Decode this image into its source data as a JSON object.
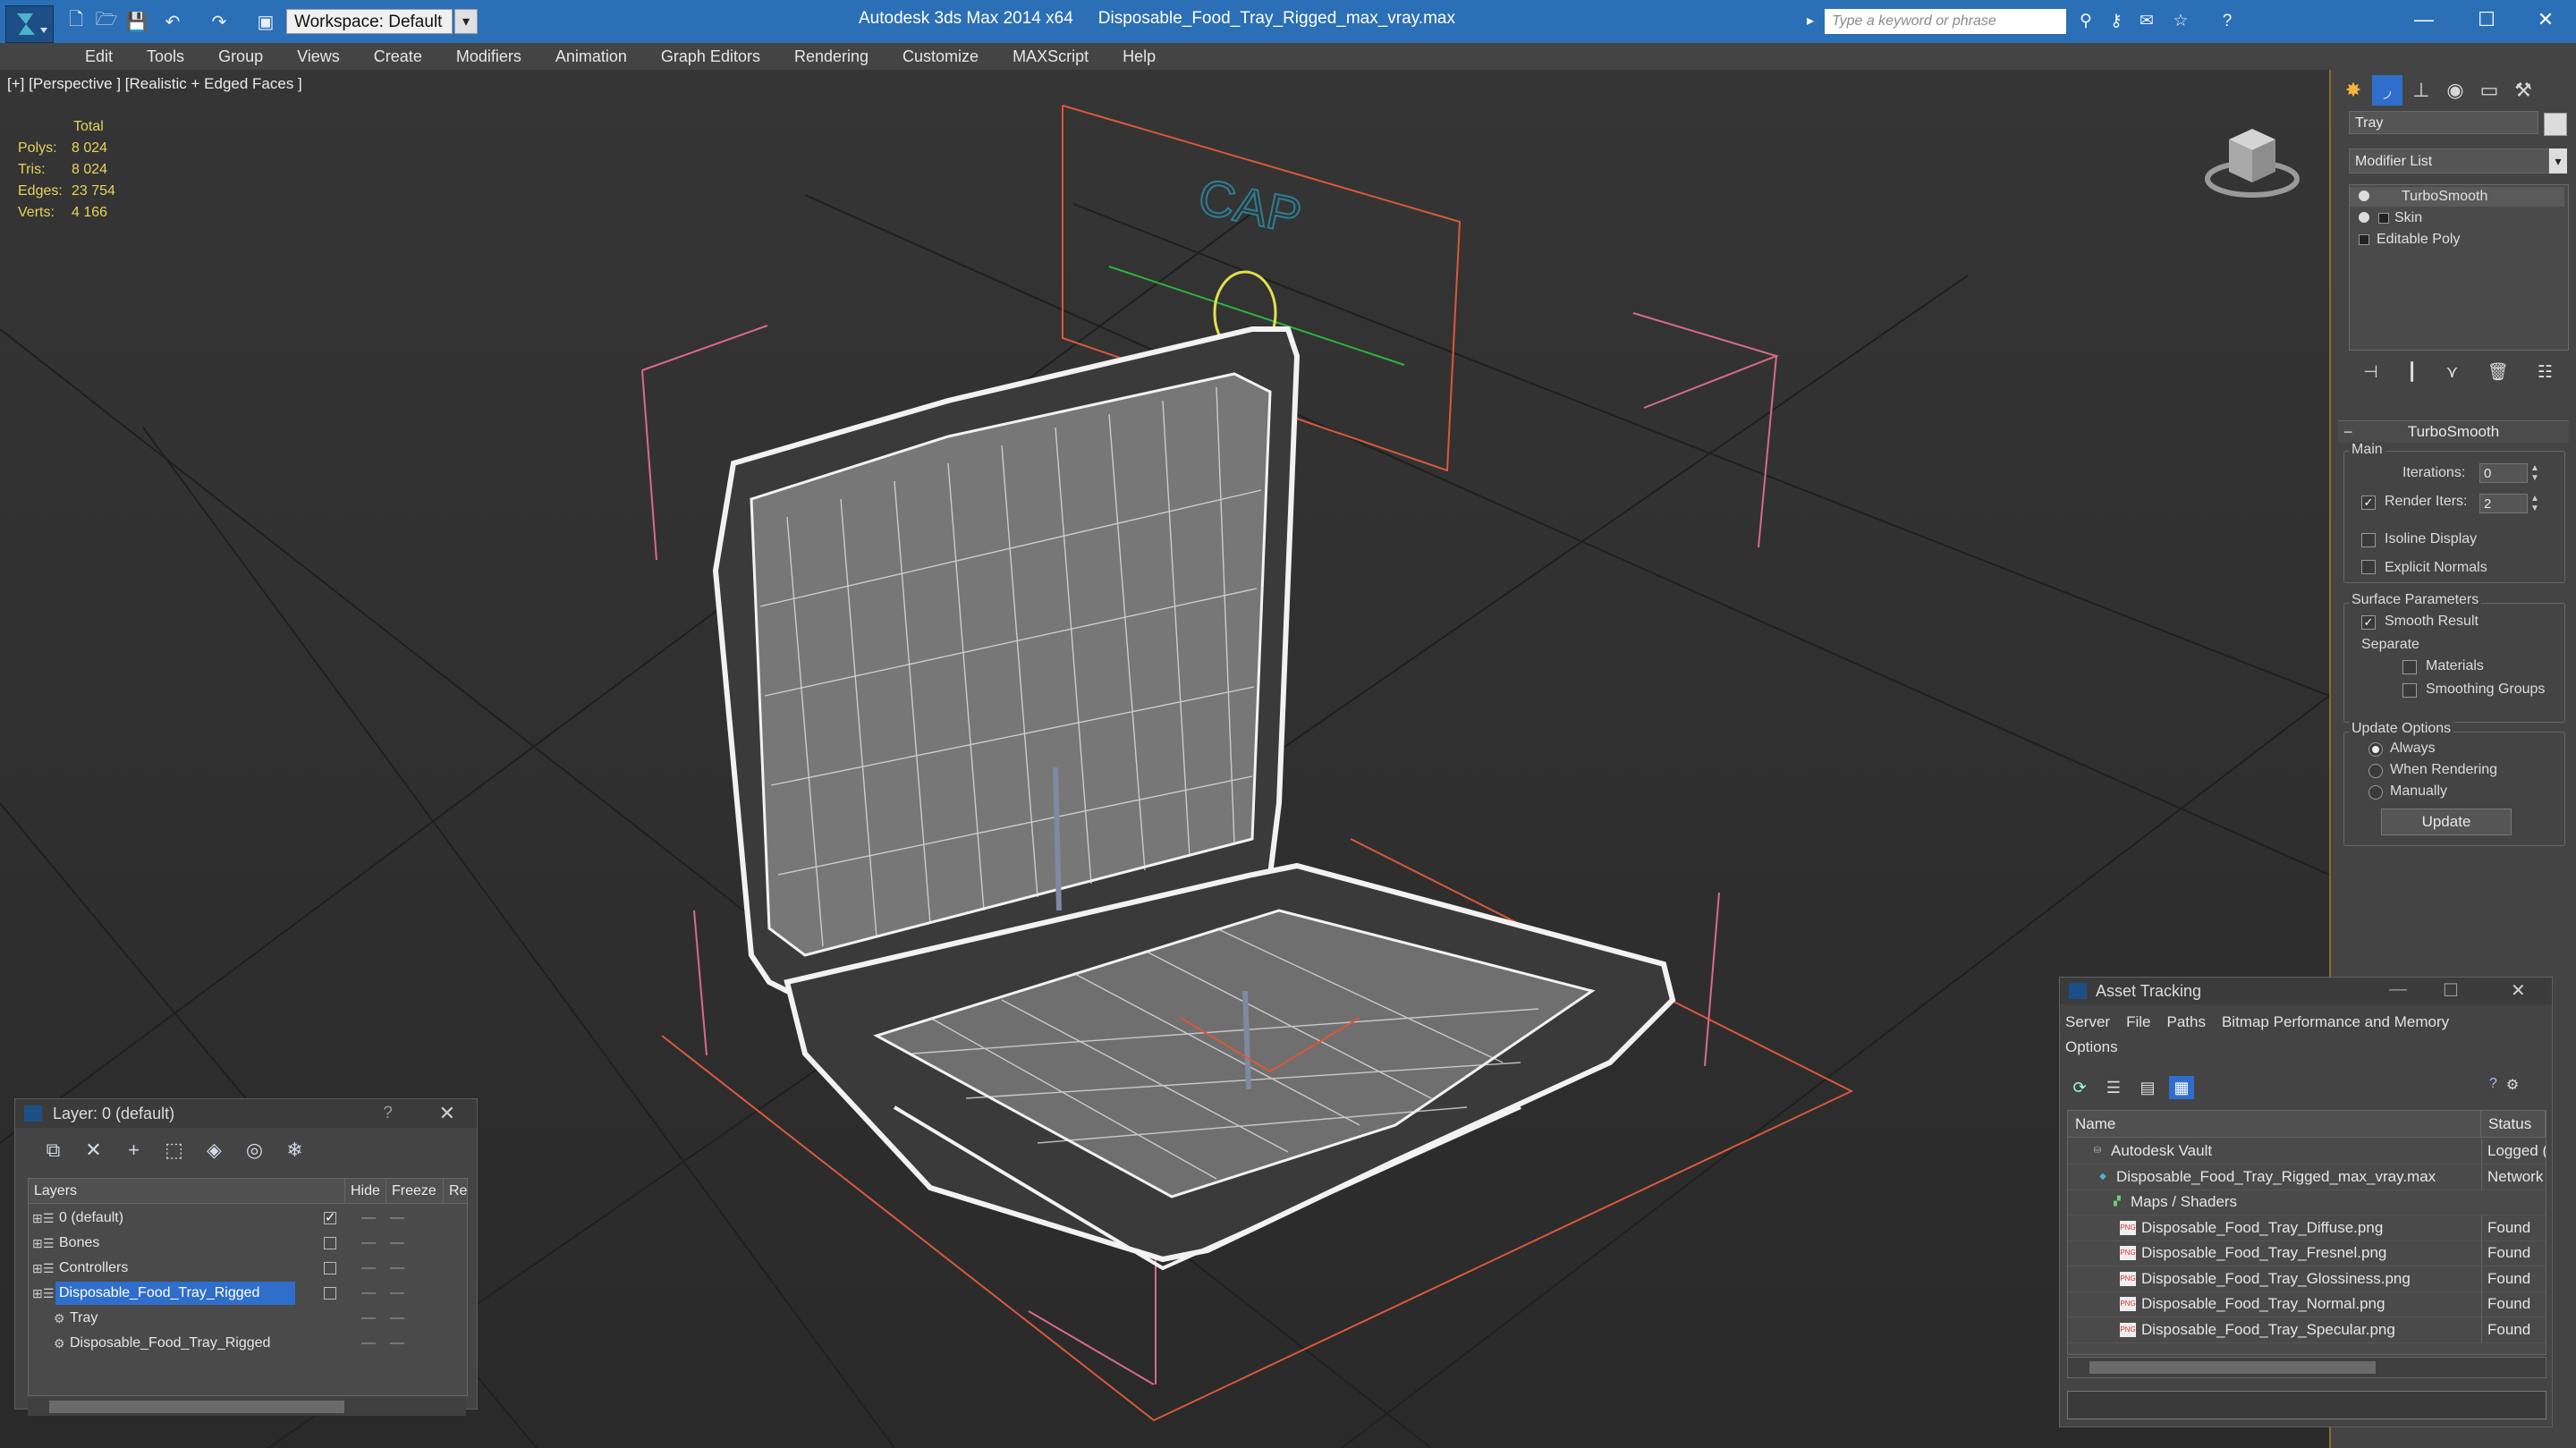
{
  "titlebar": {
    "app": "Autodesk 3ds Max  2014 x64",
    "file": "Disposable_Food_Tray_Rigged_max_vray.max",
    "workspace": "Workspace: Default",
    "search_placeholder": "Type a keyword or phrase",
    "window_controls": [
      "—",
      "☐",
      "✕"
    ]
  },
  "menubar": [
    "Edit",
    "Tools",
    "Group",
    "Views",
    "Create",
    "Modifiers",
    "Animation",
    "Graph Editors",
    "Rendering",
    "Customize",
    "MAXScript",
    "Help"
  ],
  "viewport": {
    "label": "[+] [Perspective ] [Realistic + Edged Faces ]",
    "stats": {
      "header": "Total",
      "rows": [
        {
          "k": "Polys:",
          "v": "8 024"
        },
        {
          "k": "Tris:",
          "v": "8 024"
        },
        {
          "k": "Edges:",
          "v": "23 754"
        },
        {
          "k": "Verts:",
          "v": "4 166"
        }
      ]
    },
    "gizmo_text": "CAP"
  },
  "command_panel": {
    "object_name": "Tray",
    "modifier_list": "Modifier List",
    "stack": [
      "TurboSmooth",
      "Skin",
      "Editable Poly"
    ],
    "rollout": "TurboSmooth",
    "main_group": "Main",
    "iterations_label": "Iterations:",
    "iterations_value": "0",
    "render_iters_label": "Render Iters:",
    "render_iters_value": "2",
    "render_iters_checked": true,
    "isoline_display": "Isoline Display",
    "explicit_normals": "Explicit Normals",
    "surface_params": "Surface Parameters",
    "smooth_result": "Smooth Result",
    "separate": "Separate",
    "materials": "Materials",
    "smoothing_groups": "Smoothing Groups",
    "update_options": "Update Options",
    "always": "Always",
    "when_rendering": "When Rendering",
    "manually": "Manually",
    "update_button": "Update"
  },
  "layer_panel": {
    "title": "Layer: 0 (default)",
    "help": "?",
    "close": "✕",
    "columns": [
      "Layers",
      "Hide",
      "Freeze",
      "Re"
    ],
    "rows": [
      {
        "name": "0 (default)",
        "indent": 0,
        "checked": true
      },
      {
        "name": "Bones",
        "indent": 0,
        "checked": false
      },
      {
        "name": "Controllers",
        "indent": 0,
        "checked": false
      },
      {
        "name": "Disposable_Food_Tray_Rigged",
        "indent": 0,
        "checked": false,
        "selected": true
      },
      {
        "name": "Tray",
        "indent": 1
      },
      {
        "name": "Disposable_Food_Tray_Rigged",
        "indent": 1
      }
    ]
  },
  "asset_tracking": {
    "title": "Asset Tracking",
    "menu_line1": [
      "Server",
      "File",
      "Paths",
      "Bitmap Performance and Memory"
    ],
    "menu_line2": [
      "Options"
    ],
    "columns": [
      "Name",
      "Status"
    ],
    "rows": [
      {
        "name": "Autodesk Vault",
        "status": "Logged (",
        "indent": 1,
        "icon": "vault"
      },
      {
        "name": "Disposable_Food_Tray_Rigged_max_vray.max",
        "status": "Network",
        "indent": 2,
        "icon": "max"
      },
      {
        "name": "Maps / Shaders",
        "status": "",
        "indent": 3,
        "icon": "maps"
      },
      {
        "name": "Disposable_Food_Tray_Diffuse.png",
        "status": "Found",
        "indent": 4,
        "icon": "png"
      },
      {
        "name": "Disposable_Food_Tray_Fresnel.png",
        "status": "Found",
        "indent": 4,
        "icon": "png"
      },
      {
        "name": "Disposable_Food_Tray_Glossiness.png",
        "status": "Found",
        "indent": 4,
        "icon": "png"
      },
      {
        "name": "Disposable_Food_Tray_Normal.png",
        "status": "Found",
        "indent": 4,
        "icon": "png"
      },
      {
        "name": "Disposable_Food_Tray_Specular.png",
        "status": "Found",
        "indent": 4,
        "icon": "png"
      }
    ]
  },
  "colors": {
    "titlebar": "#2b6fb6",
    "selection": "#2f6ecb",
    "stats_text": "#e8d25a",
    "gizmo_orange": "#d9583b",
    "gizmo_pink": "#d86a8a"
  }
}
